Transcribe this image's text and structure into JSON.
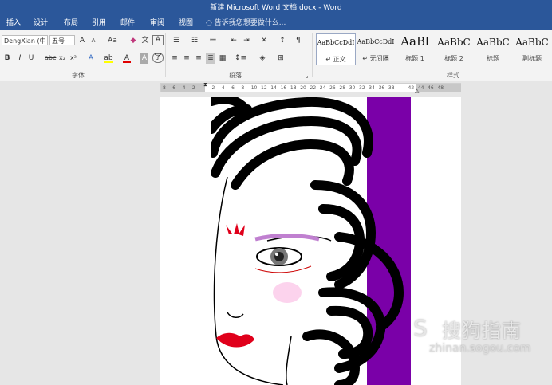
{
  "window": {
    "title": "新建 Microsoft Word 文档.docx - Word"
  },
  "tabs": [
    "插入",
    "设计",
    "布局",
    "引用",
    "邮件",
    "审阅",
    "视图"
  ],
  "tell_me": "告诉我您想要做什么...",
  "font": {
    "name": "DengXian (中",
    "size": "五号",
    "group_label": "字体"
  },
  "paragraph": {
    "group_label": "段落"
  },
  "styles": {
    "group_label": "样式",
    "items": [
      {
        "preview": "AaBbCcDdI",
        "name": "↵ 正文"
      },
      {
        "preview": "AaBbCcDdI",
        "name": "↵ 无间隔"
      },
      {
        "preview": "AaBl",
        "name": "标题 1"
      },
      {
        "preview": "AaBbC",
        "name": "标题 2"
      },
      {
        "preview": "AaBbC",
        "name": "标题"
      },
      {
        "preview": "AaBbC",
        "name": "副标题"
      }
    ]
  },
  "ruler": {
    "ticks": [
      "8",
      "6",
      "4",
      "2",
      "",
      "2",
      "4",
      "6",
      "8",
      "10",
      "12",
      "14",
      "16",
      "18",
      "20",
      "22",
      "24",
      "26",
      "28",
      "30",
      "32",
      "34",
      "36",
      "38",
      "",
      "42",
      "44",
      "46",
      "48"
    ]
  },
  "watermark": {
    "main": "搜狗指南",
    "url": "zhinan.sogou.com"
  },
  "colors": {
    "title_bar": "#2b579a",
    "artwork_purple": "#7a00a8",
    "lip_red": "#e0001b"
  }
}
